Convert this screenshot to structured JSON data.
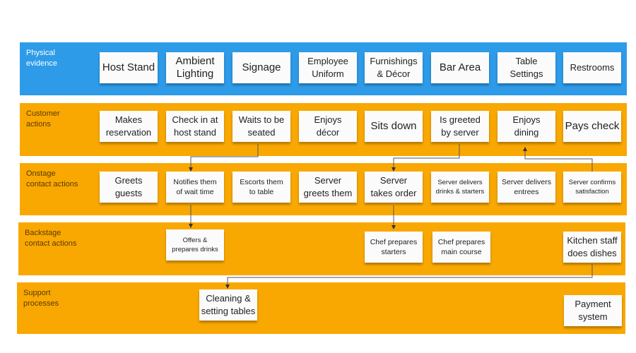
{
  "colors": {
    "physical": "#2e9be8",
    "lane": "#f9a802",
    "card": "#fbfbfb",
    "connector": "#555555"
  },
  "lanes": [
    {
      "label": "Physical\nevidence"
    },
    {
      "label": "Customer\nactions"
    },
    {
      "label": "Onstage\ncontact actions"
    },
    {
      "label": "Backstage\ncontact actions"
    },
    {
      "label": "Support\nprocesses"
    }
  ],
  "physical": [
    "Host Stand",
    "Ambient\nLighting",
    "Signage",
    "Employee\nUniform",
    "Furnishings\n& Décor",
    "Bar Area",
    "Table\nSettings",
    "Restrooms"
  ],
  "customer": [
    "Makes\nreservation",
    "Check in at\nhost stand",
    "Waits to be\nseated",
    "Enjoys\ndécor",
    "Sits down",
    "Is greeted\nby server",
    "Enjoys\ndining",
    "Pays check"
  ],
  "onstage": [
    "Greets\nguests",
    "Notifies them\nof wait time",
    "Escorts them\nto table",
    "Server\ngreets them",
    "Server\ntakes order",
    "Server delivers\ndrinks & starters",
    "Server delivers\nentrees",
    "Server confirms\nsatisfaction"
  ],
  "backstage": [
    "Offers &\nprepares drinks",
    "Chef prepares\nstarters",
    "Chef prepares\nmain course",
    "Kitchen staff\ndoes dishes"
  ],
  "support": [
    "Cleaning &\nsetting tables",
    "Payment\nsystem"
  ]
}
